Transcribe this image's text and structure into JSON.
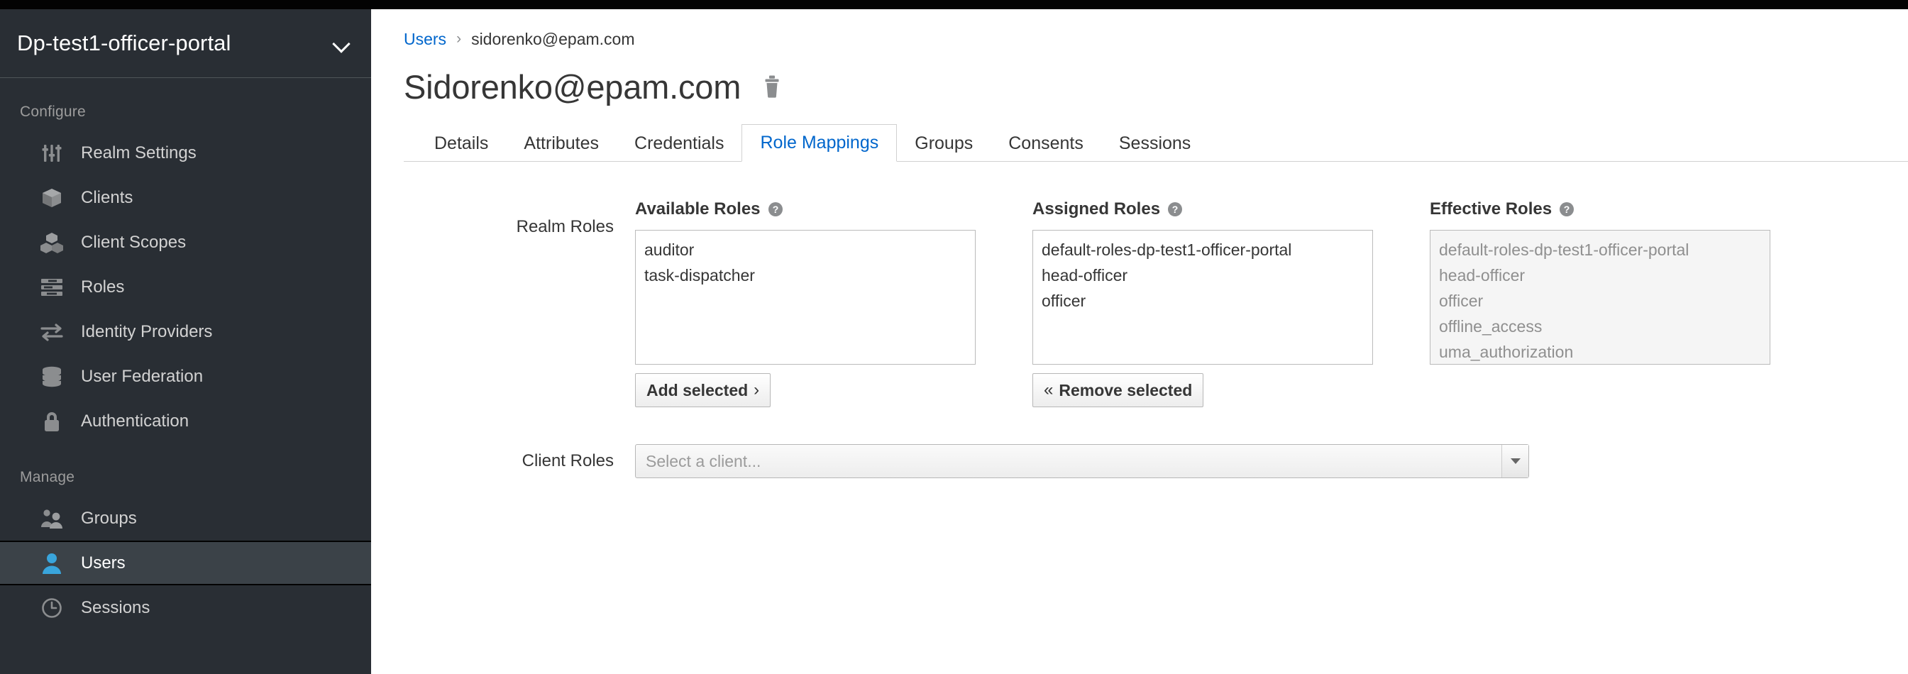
{
  "sidebar": {
    "realm_name": "Dp-test1-officer-portal",
    "chevron_icon": "chevron-down-icon",
    "sections": [
      {
        "title": "Configure",
        "items": [
          {
            "label": "Realm Settings",
            "icon": "sliders-icon",
            "selected": false
          },
          {
            "label": "Clients",
            "icon": "cube-icon",
            "selected": false
          },
          {
            "label": "Client Scopes",
            "icon": "cubes-icon",
            "selected": false
          },
          {
            "label": "Roles",
            "icon": "list-bars-icon",
            "selected": false
          },
          {
            "label": "Identity Providers",
            "icon": "exchange-arrows-icon",
            "selected": false
          },
          {
            "label": "User Federation",
            "icon": "database-icon",
            "selected": false
          },
          {
            "label": "Authentication",
            "icon": "lock-icon",
            "selected": false
          }
        ]
      },
      {
        "title": "Manage",
        "items": [
          {
            "label": "Groups",
            "icon": "users-group-icon",
            "selected": false
          },
          {
            "label": "Users",
            "icon": "user-icon",
            "selected": true
          },
          {
            "label": "Sessions",
            "icon": "clock-icon",
            "selected": false
          }
        ]
      }
    ]
  },
  "breadcrumb": {
    "parent": "Users",
    "separator": "›",
    "current": "sidorenko@epam.com"
  },
  "page": {
    "title": "Sidorenko@epam.com",
    "delete_icon": "trash-icon"
  },
  "tabs": [
    {
      "label": "Details",
      "active": false
    },
    {
      "label": "Attributes",
      "active": false
    },
    {
      "label": "Credentials",
      "active": false
    },
    {
      "label": "Role Mappings",
      "active": true
    },
    {
      "label": "Groups",
      "active": false
    },
    {
      "label": "Consents",
      "active": false
    },
    {
      "label": "Sessions",
      "active": false
    }
  ],
  "role_mappings": {
    "realm_roles_label": "Realm Roles",
    "client_roles_label": "Client Roles",
    "available": {
      "heading": "Available Roles",
      "help_icon": "help-circle-icon",
      "options": [
        "auditor",
        "task-dispatcher"
      ],
      "button": "Add selected",
      "button_chevron": "›",
      "disabled": false
    },
    "assigned": {
      "heading": "Assigned Roles",
      "help_icon": "help-circle-icon",
      "options": [
        "default-roles-dp-test1-officer-portal",
        "head-officer",
        "officer"
      ],
      "button": "Remove selected",
      "button_chevron": "«",
      "disabled": false
    },
    "effective": {
      "heading": "Effective Roles",
      "help_icon": "help-circle-icon",
      "options": [
        "default-roles-dp-test1-officer-portal",
        "head-officer",
        "officer",
        "offline_access",
        "uma_authorization"
      ],
      "disabled": true
    },
    "client_select": {
      "placeholder": "Select a client...",
      "value": "",
      "arrow_icon": "caret-down-icon"
    }
  },
  "colors": {
    "sidebar_bg": "#292e34",
    "sidebar_selected_bg": "#3b4248",
    "accent_blue": "#0066cc",
    "icon_blue": "#39a5dc",
    "topbar_black": "#030303",
    "text_dark": "#363636",
    "muted_grey": "#8f8f8f"
  }
}
